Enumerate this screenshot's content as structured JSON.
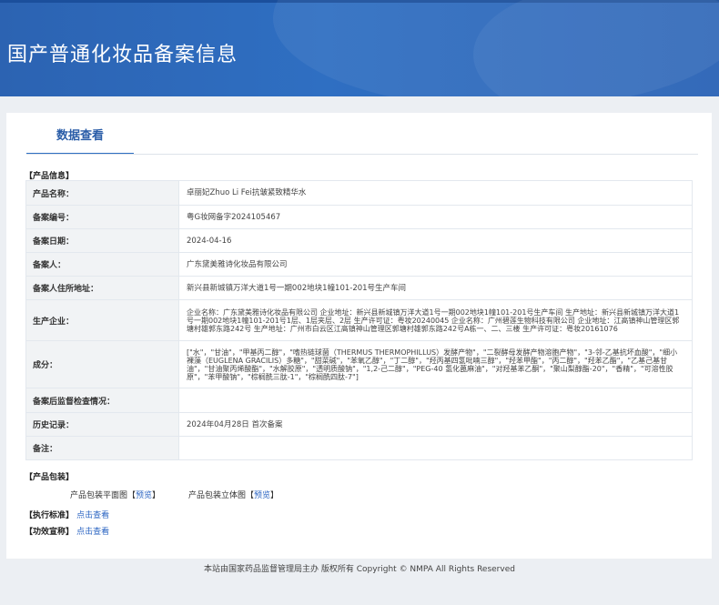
{
  "header": {
    "title": "国产普通化妆品备案信息"
  },
  "tabs": {
    "active": "数据查看"
  },
  "product_info": {
    "section_title": "【产品信息】",
    "rows": [
      {
        "label": "产品名称：",
        "value": "卓丽妃Zhuo Li Fei抗皱紧致精华水"
      },
      {
        "label": "备案编号：",
        "value": "粤G妆网备字2024105467"
      },
      {
        "label": "备案日期：",
        "value": "2024-04-16"
      },
      {
        "label": "备案人：",
        "value": "广东黛美雅诗化妆品有限公司"
      },
      {
        "label": "备案人住所地址：",
        "value": "新兴县新城镇万洋大道1号一期002地块1幢101-201号生产车间"
      },
      {
        "label": "生产企业：",
        "value": "企业名称：广东黛美雅诗化妆品有限公司 企业地址：新兴县新城镇万洋大道1号一期002地块1幢101-201号生产车间 生产地址：新兴县新城镇万洋大道1号一期002地块1幢101-201号1层、1层夹层、2层 生产许可证：粤妆20240045 企业名称：广州碧莲生物科技有限公司 企业地址：江高镇神山管理区郭塘村雄郭东路242号 生产地址：广州市白云区江高镇神山管理区郭塘村雄郭东路242号A栋一、二、三楼 生产许可证：粤妆20161076"
      },
      {
        "label": "成分：",
        "value": "[\"水\"，\"甘油\"，\"甲基丙二醇\"，\"嗜热链球菌（THERMUS THERMOPHILLUS）发酵产物\"，\"二裂酵母发酵产物溶胞产物\"，\"3-邻-乙基抗坏血酸\"，\"细小裸藻（EUGLENA GRACILIS）多糖\"，\"甜菜碱\"，\"苯氧乙醇\"，\"丁二醇\"，\"羟丙基四氢吡喃三醇\"，\"羟苯甲酯\"，\"丙二醇\"，\"羟苯乙酯\"，\"乙基己基甘油\"，\"甘油聚丙烯酸酯\"，\"水解胶原\"，\"透明质酸钠\"，\"1,2-己二醇\"，\"PEG-40 氢化蓖麻油\"，\"对羟基苯乙酮\"，\"聚山梨醇酯-20\"，\"香精\"，\"可溶性胶原\"，\"苯甲酸钠\"，\"棕榈酰三肽-1\"，\"棕榈酰四肽-7\"]"
      },
      {
        "label": "备案后监督检查情况：",
        "value": ""
      },
      {
        "label": "历史记录：",
        "value": "2024年04月28日 首次备案"
      },
      {
        "label": "备注：",
        "value": ""
      }
    ]
  },
  "packaging": {
    "section_title": "【产品包装】",
    "flat_label": "产品包装平面图",
    "flat_link": "预览",
    "solid_label": "产品包装立体图",
    "solid_link": "预览",
    "bracket_open": "【",
    "bracket_close": "】"
  },
  "standard": {
    "section_title": "【执行标准】",
    "link": "点击查看"
  },
  "efficacy": {
    "section_title": "【功效宣称】",
    "link": "点击查看"
  },
  "footer": {
    "text": "本站由国家药品监督管理局主办 版权所有 Copyright © NMPA All Rights Reserved"
  }
}
